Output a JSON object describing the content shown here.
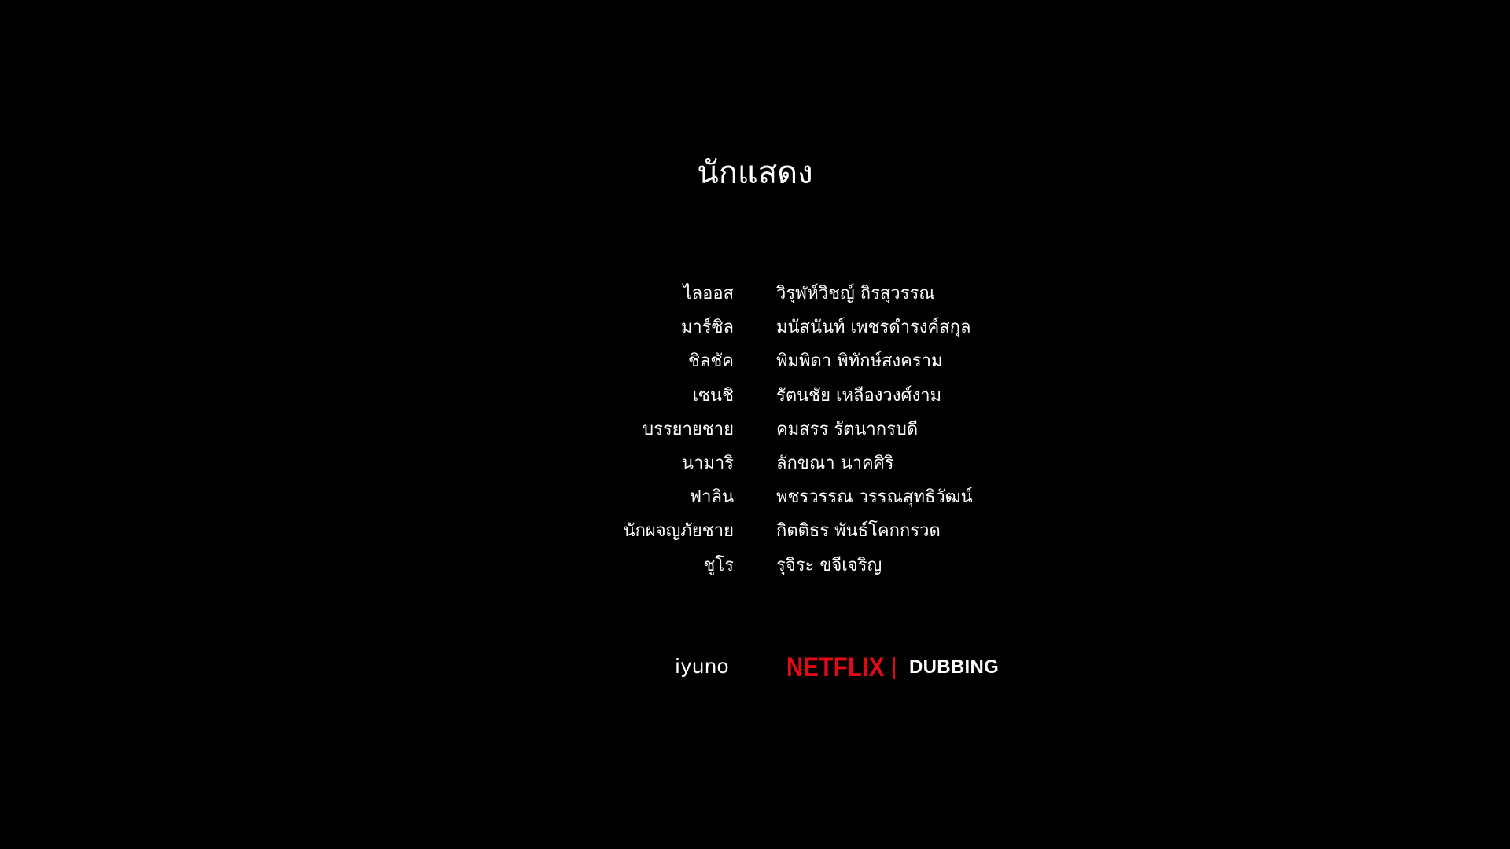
{
  "heading": "นักแสดง",
  "credits": [
    {
      "role": "ไลออส",
      "actor": "วิรุฬห์วิชญ์ ถิรสุวรรณ"
    },
    {
      "role": "มาร์ซิล",
      "actor": "มนัสนันท์ เพชรดำรงค์สกุล"
    },
    {
      "role": "ชิลชัค",
      "actor": "พิมพิดา พิทักษ์สงคราม"
    },
    {
      "role": "เซนชิ",
      "actor": "รัตนชัย เหลืองวงศ์งาม"
    },
    {
      "role": "บรรยายชาย",
      "actor": "คมสรร รัตนากรบดี"
    },
    {
      "role": "นามาริ",
      "actor": "ลักขณา นาคศิริ"
    },
    {
      "role": "ฟาลิน",
      "actor": "พชรวรรณ วรรณสุทธิวัฒน์"
    },
    {
      "role": "นักผจญภัยชาย",
      "actor": "กิตติธร พันธ์โคกกรวด"
    },
    {
      "role": "ชูโร",
      "actor": "รุจิระ ขจีเจริญ"
    }
  ],
  "footer": {
    "partner_logo": "iyuno",
    "brand_logo": "NETFLIX",
    "brand_color": "#e50914",
    "service_label": "DUBBING"
  }
}
